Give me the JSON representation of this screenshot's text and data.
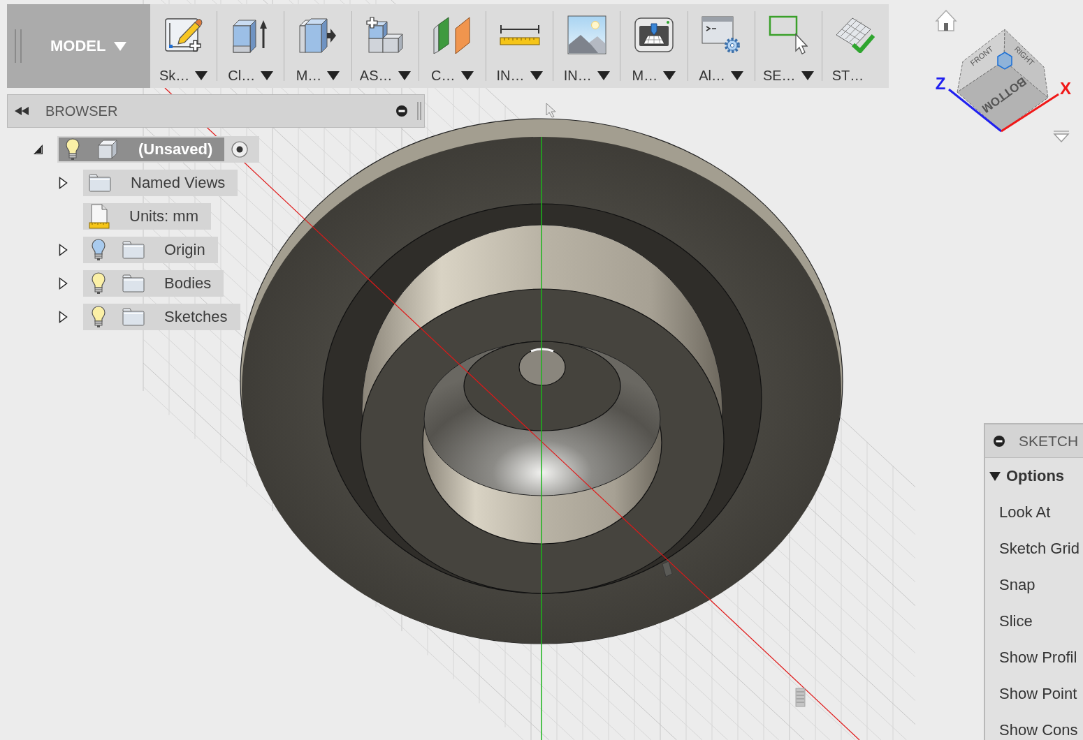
{
  "toolbar": {
    "workspace": {
      "label": "MODEL",
      "dropdown": true
    },
    "tools": [
      {
        "kind": "sketch",
        "label": "Sk…",
        "dropdown": true
      },
      {
        "kind": "create",
        "label": "Cl…",
        "dropdown": true
      },
      {
        "kind": "modify",
        "label": "M…",
        "dropdown": true
      },
      {
        "kind": "assemble",
        "label": "AS…",
        "dropdown": true
      },
      {
        "kind": "construct",
        "label": "C…",
        "dropdown": true
      },
      {
        "kind": "inspect",
        "label": "IN…",
        "dropdown": true
      },
      {
        "kind": "insert",
        "label": "IN…",
        "dropdown": true
      },
      {
        "kind": "make",
        "label": "M…",
        "dropdown": true
      },
      {
        "kind": "addins",
        "label": "Al…",
        "dropdown": true
      },
      {
        "kind": "select",
        "label": "SE…",
        "dropdown": true
      },
      {
        "kind": "stop",
        "label": "ST…",
        "dropdown": false
      }
    ]
  },
  "browser": {
    "title": "BROWSER",
    "tree": [
      {
        "label": "(Unsaved)",
        "kind": "component",
        "expanded": true,
        "visible": true,
        "active": true,
        "children": [
          {
            "label": "Named Views",
            "kind": "folder",
            "expanded": false
          },
          {
            "label": "Units: mm",
            "kind": "units"
          },
          {
            "label": "Origin",
            "kind": "folder",
            "expanded": false,
            "visible": false
          },
          {
            "label": "Bodies",
            "kind": "folder",
            "expanded": false,
            "visible": true
          },
          {
            "label": "Sketches",
            "kind": "folder",
            "expanded": false,
            "visible": true
          }
        ]
      }
    ]
  },
  "view_cube": {
    "faces": [
      {
        "label": "FRONT"
      },
      {
        "label": "RIGHT"
      },
      {
        "label": "BOTTOM"
      }
    ],
    "axes": [
      {
        "label": "Z",
        "color": "#2020f0"
      },
      {
        "label": "X",
        "color": "#f01818"
      }
    ]
  },
  "sketch_palette": {
    "title": "SKETCH",
    "section": {
      "label": "Options",
      "expanded": true
    },
    "items": [
      "Look At",
      "Sketch Grid",
      "Snap",
      "Slice",
      "Show Profil",
      "Show Point",
      "Show Cons"
    ]
  }
}
